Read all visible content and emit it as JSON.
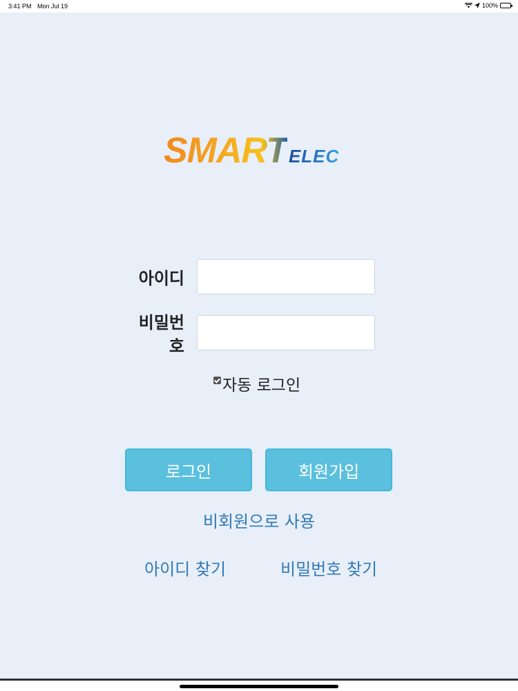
{
  "status_bar": {
    "time": "3:41 PM",
    "date": "Mon Jul 19",
    "battery": "100%"
  },
  "logo": {
    "main": "SMART",
    "sub": "ELEC"
  },
  "form": {
    "id_label": "아이디",
    "password_label": "비밀번호",
    "id_value": "",
    "password_value": "",
    "auto_login_label": "자동 로그인",
    "auto_login_checked": true
  },
  "buttons": {
    "login": "로그인",
    "signup": "회원가입"
  },
  "links": {
    "guest": "비회원으로 사용",
    "find_id": "아이디 찾기",
    "find_password": "비밀번호 찾기"
  },
  "colors": {
    "background": "#e8eff9",
    "button": "#5bc0de",
    "link": "#337ab7"
  }
}
